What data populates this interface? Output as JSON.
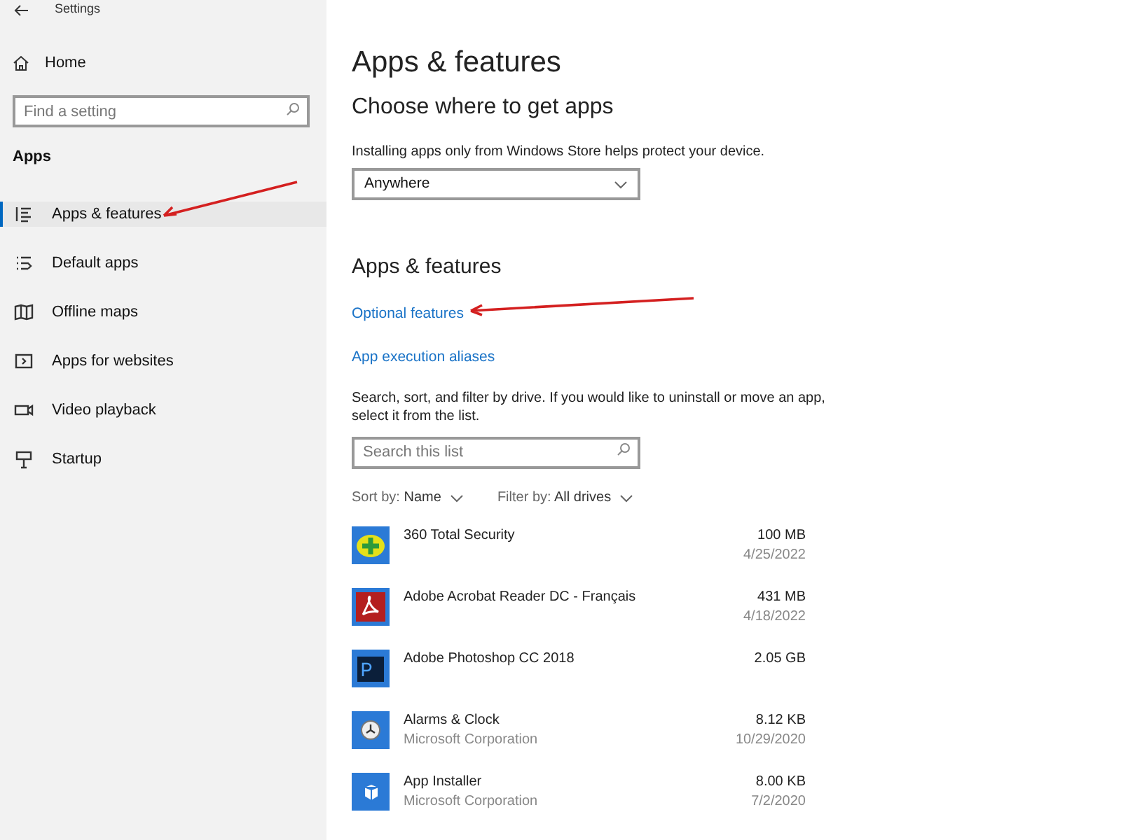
{
  "window": {
    "title": "Settings"
  },
  "sidebar": {
    "home": "Home",
    "search": {
      "placeholder": "Find a setting"
    },
    "section": "Apps",
    "items": [
      {
        "label": "Apps & features",
        "selected": true
      },
      {
        "label": "Default apps",
        "selected": false
      },
      {
        "label": "Offline maps",
        "selected": false
      },
      {
        "label": "Apps for websites",
        "selected": false
      },
      {
        "label": "Video playback",
        "selected": false
      },
      {
        "label": "Startup",
        "selected": false
      }
    ]
  },
  "main": {
    "title": "Apps & features",
    "choose": {
      "heading": "Choose where to get apps",
      "description": "Installing apps only from Windows Store helps protect your device.",
      "dropdown": "Anywhere"
    },
    "features": {
      "heading": "Apps & features",
      "links": [
        "Optional features",
        "App execution aliases"
      ],
      "description": "Search, sort, and filter by drive. If you would like to uninstall or move an app, select it from the list.",
      "search": {
        "placeholder": "Search this list"
      },
      "sort": {
        "label": "Sort by:",
        "value": "Name"
      },
      "filter": {
        "label": "Filter by:",
        "value": "All drives"
      }
    },
    "apps": [
      {
        "name": "360 Total Security",
        "size": "100 MB",
        "date": "4/25/2022"
      },
      {
        "name": "Adobe Acrobat Reader DC - Français",
        "size": "431 MB",
        "date": "4/18/2022"
      },
      {
        "name": "Adobe Photoshop CC 2018",
        "size": "2.05 GB"
      },
      {
        "name": "Alarms & Clock",
        "publisher": "Microsoft Corporation",
        "size": "8.12 KB",
        "date": "10/29/2020"
      },
      {
        "name": "App Installer",
        "publisher": "Microsoft Corporation",
        "size": "8.00 KB",
        "date": "7/2/2020"
      }
    ]
  }
}
